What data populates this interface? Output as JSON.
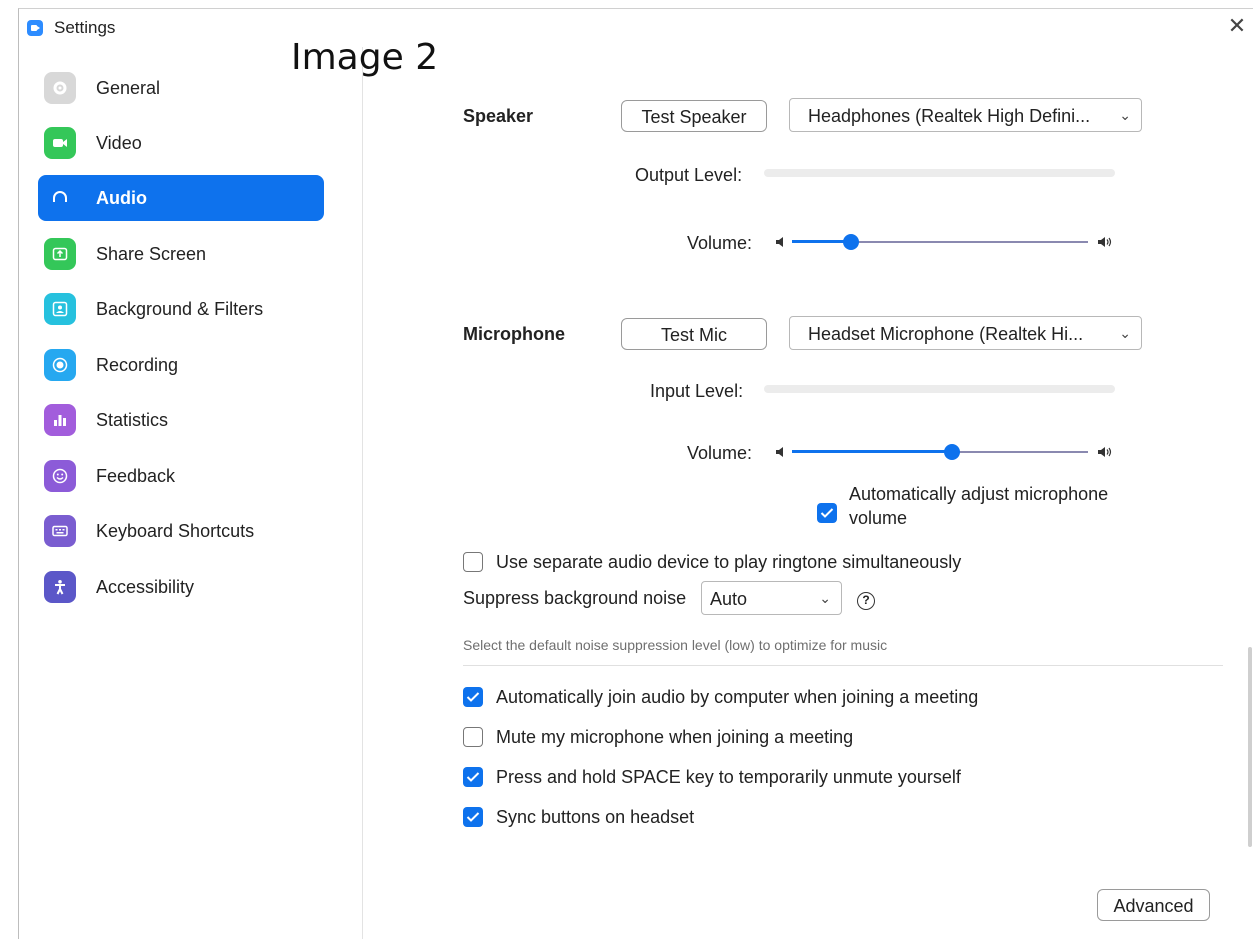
{
  "window": {
    "title": "Settings",
    "close_glyph": "✕",
    "overlay_label": "Image 2"
  },
  "sidebar": {
    "items": [
      {
        "label": "General",
        "icon": "gear-icon",
        "color": "#d8d8d8",
        "active": false
      },
      {
        "label": "Video",
        "icon": "video-camera-icon",
        "color": "#34c759",
        "active": false
      },
      {
        "label": "Audio",
        "icon": "headphones-icon",
        "color": "#0e72ed",
        "active": true
      },
      {
        "label": "Share Screen",
        "icon": "share-screen-icon",
        "color": "#34c759",
        "active": false
      },
      {
        "label": "Background & Filters",
        "icon": "person-frame-icon",
        "color": "#26c1de",
        "active": false
      },
      {
        "label": "Recording",
        "icon": "record-icon",
        "color": "#26a8f0",
        "active": false
      },
      {
        "label": "Statistics",
        "icon": "bar-chart-icon",
        "color": "#a25ddc",
        "active": false
      },
      {
        "label": "Feedback",
        "icon": "smiley-icon",
        "color": "#8c5bd8",
        "active": false
      },
      {
        "label": "Keyboard Shortcuts",
        "icon": "keyboard-icon",
        "color": "#7a5dd0",
        "active": false
      },
      {
        "label": "Accessibility",
        "icon": "accessibility-icon",
        "color": "#5b57c8",
        "active": false
      }
    ]
  },
  "speaker": {
    "label": "Speaker",
    "test_button": "Test Speaker",
    "device": "Headphones (Realtek High Defini...",
    "output_level_label": "Output Level:",
    "volume_label": "Volume:",
    "volume_fraction": 0.2
  },
  "microphone": {
    "label": "Microphone",
    "test_button": "Test Mic",
    "device": "Headset Microphone (Realtek Hi...",
    "input_level_label": "Input Level:",
    "volume_label": "Volume:",
    "volume_fraction": 0.54,
    "auto_adjust_line1": "Automatically adjust microphone",
    "auto_adjust_line2": "volume",
    "auto_adjust_checked": true
  },
  "options": {
    "separate_ringtone": {
      "label": "Use separate audio device to play ringtone simultaneously",
      "checked": false
    },
    "suppress_label": "Suppress background noise",
    "suppress_value": "Auto",
    "help_glyph": "?",
    "suppress_hint": "Select the default noise suppression level (low) to optimize for music",
    "auto_join": {
      "label": "Automatically join audio by computer when joining a meeting",
      "checked": true
    },
    "mute_on_join": {
      "label": "Mute my microphone when joining a meeting",
      "checked": false
    },
    "space_unmute": {
      "label": "Press and hold SPACE key to temporarily unmute yourself",
      "checked": true
    },
    "sync_headset": {
      "label": "Sync buttons on headset",
      "checked": true
    }
  },
  "advanced_button": "Advanced",
  "colors": {
    "accent": "#0e72ed",
    "track": "#8a89b0",
    "level_bar": "#ececec"
  }
}
